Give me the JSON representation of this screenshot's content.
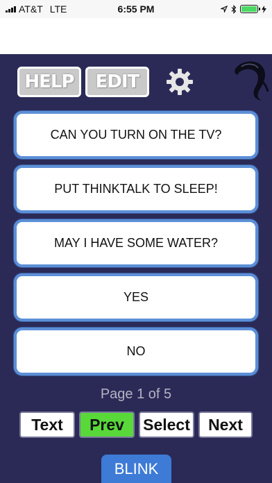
{
  "status_bar": {
    "carrier": "AT&T",
    "network": "LTE",
    "time": "6:55 PM"
  },
  "toolbar": {
    "help_label": "HELP",
    "edit_label": "EDIT"
  },
  "phrases": [
    "CAN YOU TURN ON THE TV?",
    "PUT THINKTALK TO SLEEP!",
    "MAY I HAVE SOME WATER?",
    "YES",
    "NO"
  ],
  "page_indicator": "Page 1 of 5",
  "nav": {
    "text_label": "Text",
    "prev_label": "Prev",
    "select_label": "Select",
    "next_label": "Next"
  },
  "blink_label": "BLINK",
  "colors": {
    "background": "#2b2a57",
    "phrase_border": "#5c8fd6",
    "active_button": "#59d83a",
    "blink_button": "#3d7bd6"
  }
}
